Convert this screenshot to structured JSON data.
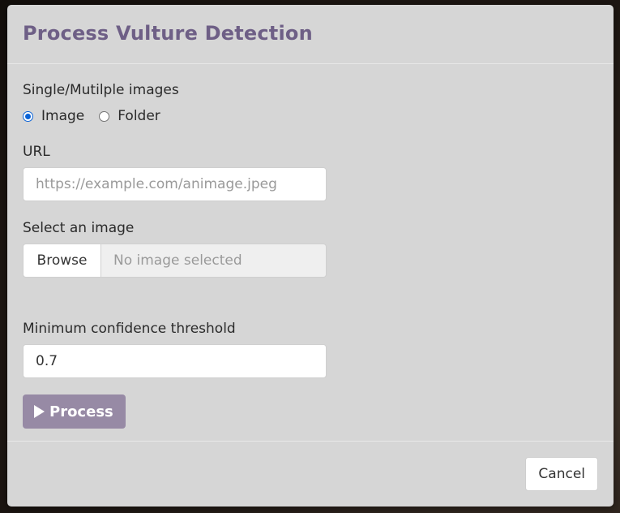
{
  "modal": {
    "title": "Process Vulture Detection"
  },
  "mode": {
    "label": "Single/Mutilple images",
    "options": [
      {
        "label": "Image",
        "checked": true
      },
      {
        "label": "Folder",
        "checked": false
      }
    ]
  },
  "url_field": {
    "label": "URL",
    "value": "",
    "placeholder": "https://example.com/animage.jpeg"
  },
  "image_select": {
    "label": "Select an image",
    "browse_label": "Browse",
    "status_text": "No image selected"
  },
  "threshold": {
    "label": "Minimum confidence threshold",
    "value": "0.7"
  },
  "actions": {
    "process_label": "Process",
    "cancel_label": "Cancel"
  },
  "colors": {
    "title": "#6e5f86",
    "process_button": "#978aa5",
    "modal_background": "#d6d6d6",
    "radio_accent": "#0b63d6"
  },
  "icons": {
    "process": "play-icon"
  }
}
